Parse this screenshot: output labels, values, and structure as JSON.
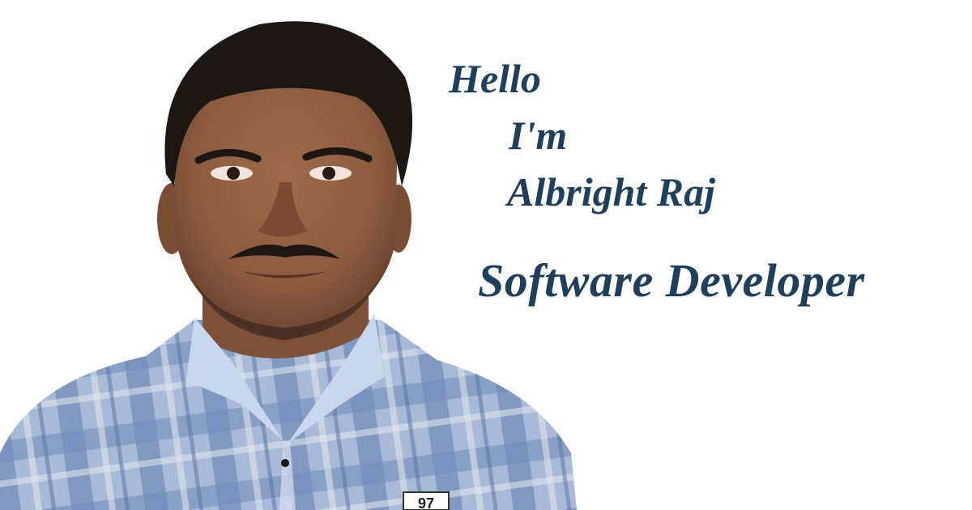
{
  "colors": {
    "text": "#1f3f5b",
    "background": "#ffffff",
    "shirt_base": "#a9bfe0",
    "shirt_stripe": "#6b86b5",
    "skin": "#8a5a3e",
    "hair": "#1c1712"
  },
  "intro": {
    "line1": "Hello",
    "line2": "I'm",
    "name": "Albright Raj",
    "title": "Software Developer"
  },
  "shirt_badge": "97"
}
